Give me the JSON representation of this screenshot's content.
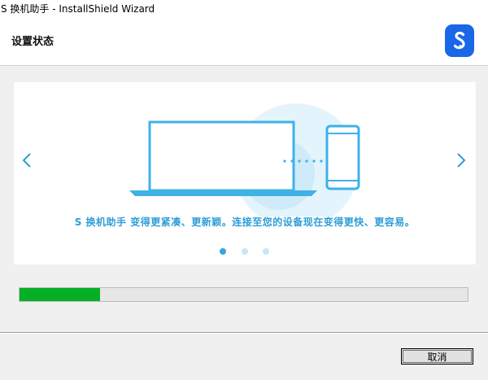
{
  "window": {
    "title": "S 换机助手 - InstallShield Wizard"
  },
  "header": {
    "title": "设置状态",
    "logo_icon": "samsung-smart-switch-logo"
  },
  "banner": {
    "caption": "S 换机助手 变得更紧凑、更新颖。连接至您的设备现在变得更快、更容易。",
    "slide_count": 3,
    "active_slide": 1,
    "prev_icon": "chevron-left-icon",
    "next_icon": "chevron-right-icon"
  },
  "progress": {
    "percent": 18
  },
  "buttons": {
    "cancel": "取消"
  },
  "colors": {
    "accent": "#2c9ed6",
    "progress": "#06b025",
    "logo": "#1a68e8"
  }
}
